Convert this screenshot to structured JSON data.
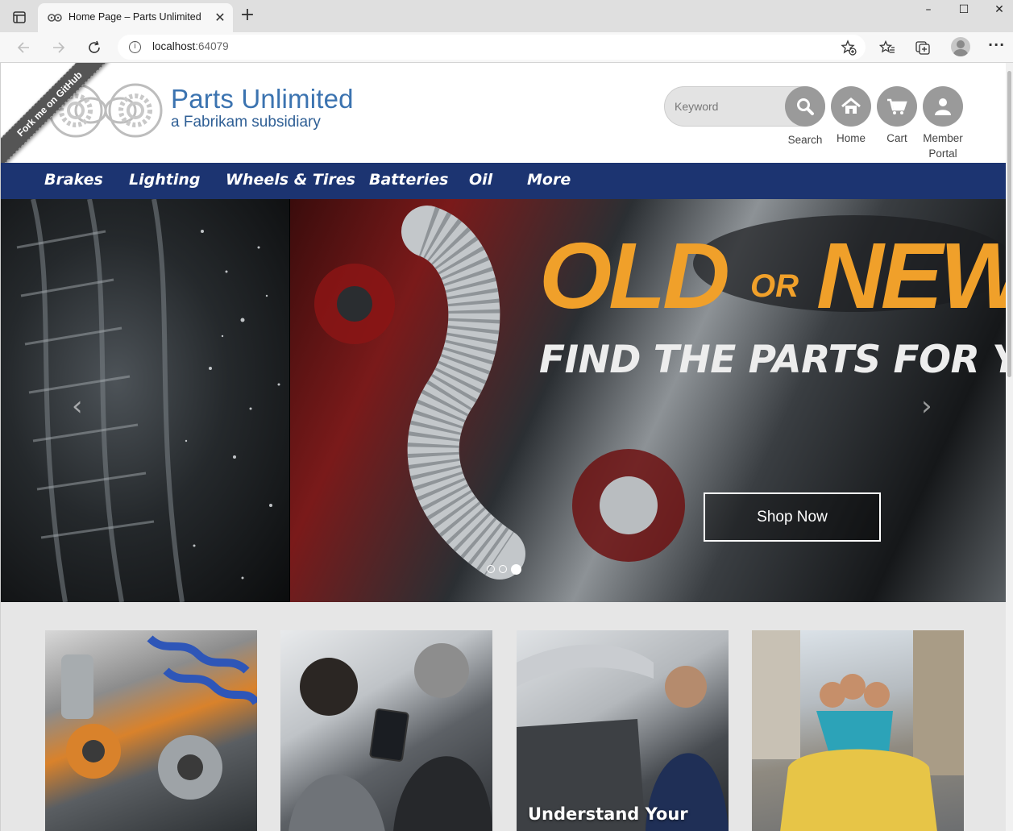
{
  "browser": {
    "tab_title": "Home Page – Parts Unlimited",
    "url_host": "localhost",
    "url_port": ":64079",
    "new_tab_symbol": "+",
    "close_symbol": "✕",
    "window_controls": {
      "minimize": "–",
      "maximize": "☐",
      "close": "✕"
    }
  },
  "site": {
    "brand_name": "Parts Unlimited",
    "brand_subtitle": "a Fabrikam subsidiary",
    "fork_ribbon": "Fork me on GitHub",
    "search_placeholder": "Keyword",
    "header_buttons": {
      "search": "Search",
      "home": "Home",
      "cart": "Cart",
      "member_line1": "Member",
      "member_line2": "Portal"
    },
    "nav": [
      "Brakes",
      "Lighting",
      "Wheels & Tires",
      "Batteries",
      "Oil",
      "More"
    ]
  },
  "hero": {
    "headline_old": "OLD",
    "headline_or": "OR",
    "headline_new": "NEW",
    "subheadline": "FIND THE PARTS FOR YOUR RIDE",
    "cta": "Shop Now",
    "slide_count": 3,
    "active_slide": 3,
    "prev_symbol": "‹",
    "next_symbol": "›"
  },
  "tiles": [
    {
      "caption": ""
    },
    {
      "caption": ""
    },
    {
      "caption": "Understand Your"
    },
    {
      "caption": ""
    }
  ],
  "colors": {
    "nav_bg": "#1c3471",
    "brand_blue": "#3b73b0",
    "headline_orange": "#f0a02a",
    "icon_gray": "#9a9a9a"
  }
}
